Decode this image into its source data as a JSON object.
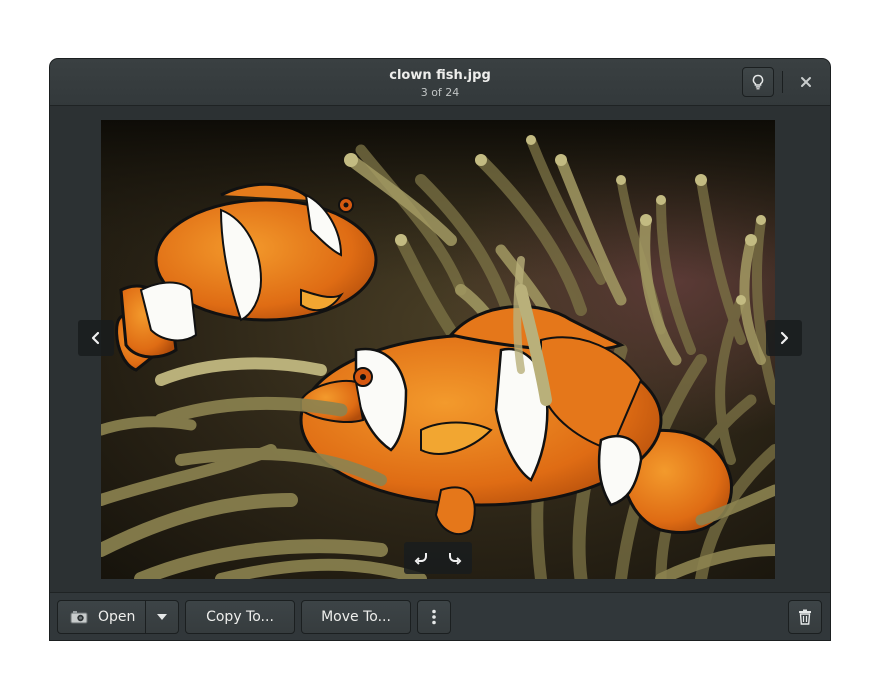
{
  "window": {
    "title": "clown fish.jpg",
    "subtitle": "3 of 24"
  },
  "header": {
    "icons": {
      "info": "lightbulb-icon",
      "close": "close-icon"
    }
  },
  "viewer": {
    "image_description_icon": "photo-clownfish",
    "nav": {
      "prev": "chevron-left-icon",
      "next": "chevron-right-icon"
    },
    "rotate": {
      "left": "rotate-left-icon",
      "right": "rotate-right-icon"
    }
  },
  "footer": {
    "open_label": "Open",
    "copy_label": "Copy To...",
    "move_label": "Move To...",
    "icons": {
      "open": "camera-icon",
      "dropdown": "chevron-down-icon",
      "more": "vertical-dots-icon",
      "delete": "trash-icon"
    }
  },
  "colors": {
    "window_bg": "#2c3133",
    "header_bg": "#383e40",
    "button_text": "#eeeeec",
    "fish_orange": "#e8761a"
  }
}
